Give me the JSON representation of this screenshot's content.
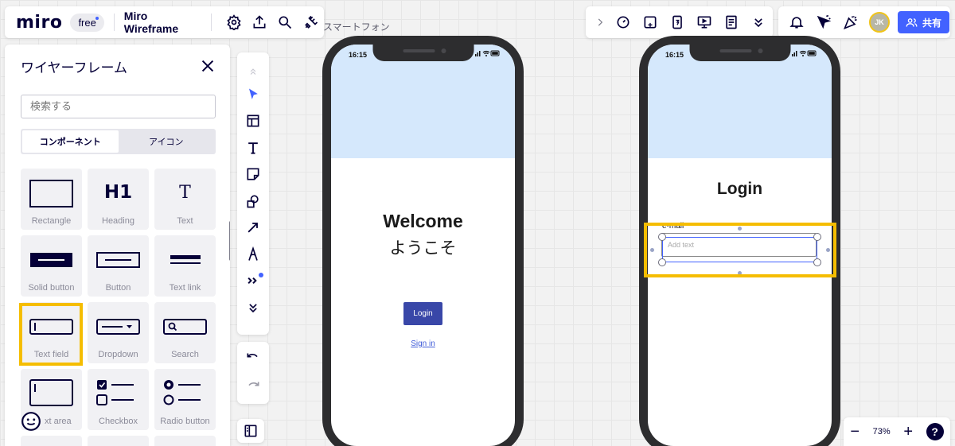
{
  "app": {
    "logo": "miro",
    "plan_badge": "free",
    "board_title": "Miro Wireframe"
  },
  "toolbar_right": {
    "share_label": "共有",
    "avatar_initials": "JK"
  },
  "panel": {
    "title": "ワイヤーフレーム",
    "search_placeholder": "検索する",
    "tabs": [
      {
        "label": "コンポーネント",
        "active": true
      },
      {
        "label": "アイコン",
        "active": false
      }
    ],
    "components": [
      {
        "label": "Rectangle",
        "icon": "rectangle-icon"
      },
      {
        "label": "Heading",
        "icon": "heading-icon",
        "glyph": "H1"
      },
      {
        "label": "Text",
        "icon": "text-icon",
        "glyph": "T"
      },
      {
        "label": "Solid button",
        "icon": "solid-button-icon"
      },
      {
        "label": "Button",
        "icon": "button-icon"
      },
      {
        "label": "Text link",
        "icon": "text-link-icon"
      },
      {
        "label": "Text field",
        "icon": "text-field-icon"
      },
      {
        "label": "Dropdown",
        "icon": "dropdown-icon"
      },
      {
        "label": "Search",
        "icon": "search-component-icon"
      },
      {
        "label": "xt area",
        "icon": "text-area-icon"
      },
      {
        "label": "Checkbox",
        "icon": "checkbox-icon"
      },
      {
        "label": "Radio button",
        "icon": "radio-button-icon"
      }
    ],
    "highlighted_component": "Text field"
  },
  "canvas": {
    "frame_label": "スマートフォン",
    "phone_welcome": {
      "time": "16:15",
      "title": "Welcome",
      "subtitle": "ようこそ",
      "button_label": "Login",
      "link_label": "Sign in"
    },
    "phone_login": {
      "time": "16:15",
      "title": "Login",
      "field_label": "e-mail",
      "field_placeholder": "Add text"
    }
  },
  "zoom": {
    "level": "73%",
    "help_label": "?"
  },
  "colors": {
    "accent": "#4262ff",
    "highlight": "#f5bd00",
    "hero": "#d5e8fc",
    "wireframe_button": "#3947a8"
  }
}
